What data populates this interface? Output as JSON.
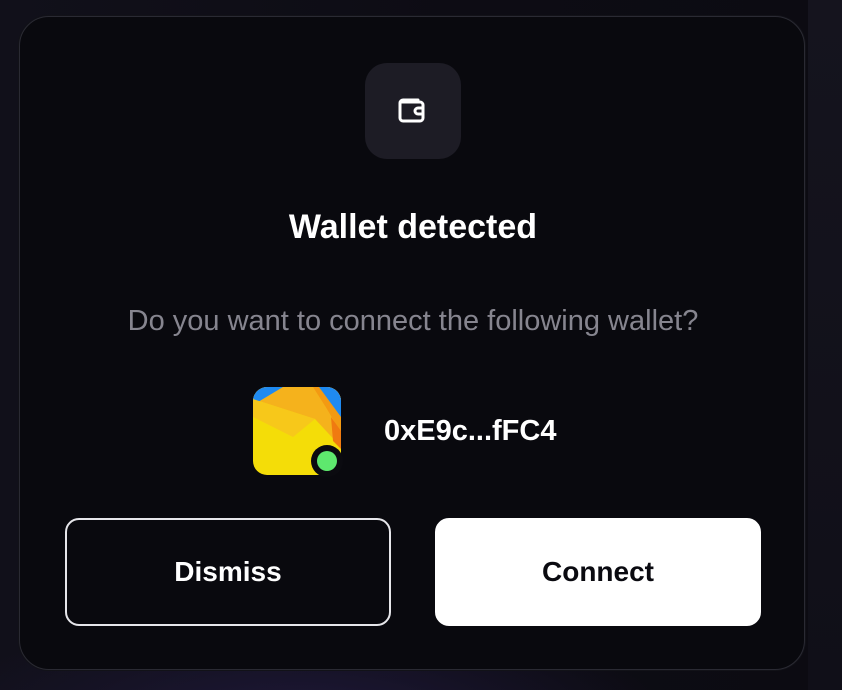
{
  "dialog": {
    "title": "Wallet detected",
    "message": "Do you want to connect the following wallet?",
    "header_icon": "wallet-icon"
  },
  "wallet": {
    "address": "0xE9c...fFC4",
    "logo_icon": "wallet-app-logo-icon",
    "status": "connected",
    "status_color": "#5ee86e"
  },
  "actions": {
    "dismiss_label": "Dismiss",
    "connect_label": "Connect"
  },
  "colors": {
    "modal_background": "#09090e",
    "primary_button": "#ffffff",
    "secondary_text": "#86858f"
  }
}
